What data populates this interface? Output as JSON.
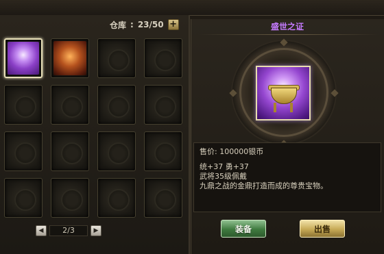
{
  "warehouse": {
    "label": "仓库",
    "capacity": "23/50",
    "expand_label": "+"
  },
  "slots": [
    {
      "state": "item",
      "item": "ding"
    },
    {
      "state": "item",
      "item": "armor"
    },
    {
      "state": "empty"
    },
    {
      "state": "empty"
    },
    {
      "state": "empty"
    },
    {
      "state": "empty"
    },
    {
      "state": "empty"
    },
    {
      "state": "empty"
    },
    {
      "state": "empty"
    },
    {
      "state": "empty"
    },
    {
      "state": "empty"
    },
    {
      "state": "empty"
    },
    {
      "state": "empty"
    },
    {
      "state": "empty"
    },
    {
      "state": "empty"
    },
    {
      "state": "empty"
    }
  ],
  "pager": {
    "prev": "◀",
    "page": "2/3",
    "next": "▶"
  },
  "detail": {
    "title": "盛世之证",
    "price": "售价: 100000银币",
    "stats": "统+37 勇+37",
    "requirement": "武将35级佩戴",
    "description": "九鼎之战的金鼎打造而成的尊贵宝物。"
  },
  "buttons": {
    "equip": "装备",
    "sell": "出售"
  },
  "colors": {
    "title": "#c57bff",
    "equip_button": "#3f7a3f",
    "sell_button": "#c6a955"
  }
}
